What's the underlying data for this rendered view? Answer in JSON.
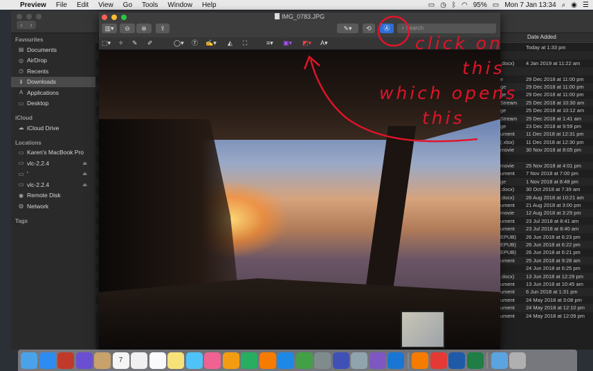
{
  "menubar": {
    "app_name": "Preview",
    "menus": [
      "File",
      "Edit",
      "View",
      "Go",
      "Tools",
      "Window",
      "Help"
    ],
    "battery": "95%",
    "clock": "Mon 7 Jan  13:34"
  },
  "finder": {
    "sidebar": {
      "favourites_heading": "Favourites",
      "favourites": [
        {
          "label": "Documents",
          "icon": "document-icon"
        },
        {
          "label": "AirDrop",
          "icon": "airdrop-icon"
        },
        {
          "label": "Recents",
          "icon": "clock-icon"
        },
        {
          "label": "Downloads",
          "icon": "download-icon",
          "selected": true
        },
        {
          "label": "Applications",
          "icon": "applications-icon"
        },
        {
          "label": "Desktop",
          "icon": "desktop-icon"
        }
      ],
      "icloud_heading": "iCloud",
      "icloud": [
        {
          "label": "iCloud Drive",
          "icon": "cloud-icon"
        }
      ],
      "locations_heading": "Locations",
      "locations": [
        {
          "label": "Karen's MacBook Pro",
          "icon": "laptop-icon",
          "eject": false
        },
        {
          "label": "vlc-2.2.4",
          "icon": "disk-icon",
          "eject": true
        },
        {
          "label": "'",
          "icon": "disk-icon",
          "eject": true
        },
        {
          "label": "vlc-2.2.4",
          "icon": "disk-icon",
          "eject": true
        },
        {
          "label": "Remote Disk",
          "icon": "remote-disk-icon",
          "eject": false
        },
        {
          "label": "Network",
          "icon": "network-icon",
          "eject": false
        }
      ],
      "tags_heading": "Tags"
    },
    "list": {
      "date_header": "Date Added",
      "rows": [
        {
          "kind": "",
          "date": "Today at 1:33 pm"
        },
        {
          "kind": "",
          "date": ""
        },
        {
          "kind": ".docx)",
          "date": "4 Jan 2019 at 11:22 am"
        },
        {
          "kind": "",
          "date": ""
        },
        {
          "kind": "e",
          "date": "29 Dec 2018 at 11:00 pm"
        },
        {
          "kind": "ge",
          "date": "29 Dec 2018 at 11:00 pm"
        },
        {
          "kind": "ge",
          "date": "29 Dec 2018 at 11:00 pm"
        },
        {
          "kind": "Stream",
          "date": "25 Dec 2018 at 10:30 am"
        },
        {
          "kind": "ge",
          "date": "25 Dec 2018 at 10:12 am"
        },
        {
          "kind": "Stream",
          "date": "25 Dec 2018 at 1:41 am"
        },
        {
          "kind": "ge",
          "date": "23 Dec 2018 at 9:59 pm"
        },
        {
          "kind": "ument",
          "date": "11 Dec 2018 at 12:31 pm"
        },
        {
          "kind": "(.xlsx)",
          "date": "11 Dec 2018 at 12:30 pm"
        },
        {
          "kind": "movie",
          "date": "30 Nov 2018 at 8:05 pm"
        },
        {
          "kind": "",
          "date": ""
        },
        {
          "kind": "movie",
          "date": "25 Nov 2018 at 4:01 pm"
        },
        {
          "kind": "ument",
          "date": "7 Nov 2018 at 7:00 pm"
        },
        {
          "kind": "ge",
          "date": "1 Nov 2018 at 8:48 pm"
        },
        {
          "kind": ".docx)",
          "date": "30 Oct 2018 at 7:39 am"
        },
        {
          "kind": ".docx)",
          "date": "28 Aug 2018 at 10:21 am"
        },
        {
          "kind": "ument",
          "date": "21 Aug 2018 at 3:00 pm"
        },
        {
          "kind": "movie",
          "date": "12 Aug 2018 at 3:29 pm"
        },
        {
          "kind": "ument",
          "date": "23 Jul 2018 at 8:41 am"
        },
        {
          "kind": "ument",
          "date": "23 Jul 2018 at 8:40 am"
        },
        {
          "kind": "EPUB)",
          "date": "26 Jun 2018 at 6:23 pm"
        },
        {
          "kind": "EPUB)",
          "date": "26 Jun 2018 at 6:22 pm"
        },
        {
          "kind": "EPUB)",
          "date": "26 Jun 2018 at 6:21 pm"
        },
        {
          "kind": "ument",
          "date": "25 Jun 2018 at 9:28 am"
        },
        {
          "kind": "",
          "date": "24 Jun 2018 at 6:25 pm"
        },
        {
          "kind": ".docx)",
          "date": "13 Jun 2018 at 12:29 pm"
        },
        {
          "kind": "ument",
          "date": "13 Jun 2018 at 10:45 am"
        },
        {
          "kind": "ument",
          "date": "6 Jun 2018 at 1:31 pm"
        },
        {
          "kind": "ument",
          "date": "24 May 2018 at 3:08 pm"
        },
        {
          "kind": "ument",
          "date": "24 May 2018 at 12:10 pm"
        },
        {
          "kind": "ument",
          "date": "24 May 2018 at 12:09 pm"
        }
      ]
    }
  },
  "preview": {
    "filename": "IMG_0783.JPG",
    "search_placeholder": "Search"
  },
  "annotations": {
    "line1": "click on",
    "line2": "this",
    "line3": "which opens",
    "line4": "this",
    "color": "#e0142a"
  },
  "dock": [
    {
      "name": "finder",
      "icon": "finder-icon",
      "color": "#4aa3e8"
    },
    {
      "name": "safari",
      "icon": "safari-icon",
      "color": "#2d8cf0"
    },
    {
      "name": "photo-booth",
      "icon": "photo-booth-icon",
      "color": "#c0392b"
    },
    {
      "name": "siri",
      "icon": "siri-icon",
      "color": "#6a4fd0"
    },
    {
      "name": "contacts",
      "icon": "contacts-icon",
      "color": "#c9a26b"
    },
    {
      "name": "calendar",
      "icon": "calendar-icon",
      "color": "#f5f5f5",
      "text": "7"
    },
    {
      "name": "photos",
      "icon": "photos-icon",
      "color": "#f0f0f0"
    },
    {
      "name": "reminders",
      "icon": "reminders-icon",
      "color": "#fafafa"
    },
    {
      "name": "notes",
      "icon": "notes-icon",
      "color": "#f7e27a"
    },
    {
      "name": "messages",
      "icon": "messages-icon",
      "color": "#4fc3f7"
    },
    {
      "name": "itunes",
      "icon": "music-icon",
      "color": "#f06292"
    },
    {
      "name": "pages",
      "icon": "pages-icon",
      "color": "#f39c12"
    },
    {
      "name": "numbers",
      "icon": "numbers-icon",
      "color": "#27ae60"
    },
    {
      "name": "vlc",
      "icon": "vlc-icon",
      "color": "#f57c00"
    },
    {
      "name": "app-store",
      "icon": "app-store-icon",
      "color": "#1e88e5"
    },
    {
      "name": "facetime",
      "icon": "facetime-icon",
      "color": "#43a047"
    },
    {
      "name": "system-preferences",
      "icon": "gear-icon",
      "color": "#7f8c8d"
    },
    {
      "name": "imovie",
      "icon": "imovie-icon",
      "color": "#3f51b5"
    },
    {
      "name": "preview",
      "icon": "preview-icon",
      "color": "#90a4ae"
    },
    {
      "name": "imovie-star",
      "icon": "star-icon",
      "color": "#7e57c2"
    },
    {
      "name": "keynote",
      "icon": "keynote-icon",
      "color": "#1976d2"
    },
    {
      "name": "sep",
      "icon": "",
      "color": ""
    },
    {
      "name": "vlc-2",
      "icon": "vlc-icon",
      "color": "#f57c00"
    },
    {
      "name": "acrobat",
      "icon": "pdf-icon",
      "color": "#e53935"
    },
    {
      "name": "word",
      "icon": "word-icon",
      "color": "#1e5aa8"
    },
    {
      "name": "excel",
      "icon": "excel-icon",
      "color": "#1e7e45"
    },
    {
      "name": "sep2",
      "icon": "",
      "color": ""
    },
    {
      "name": "downloads-folder",
      "icon": "folder-icon",
      "color": "#5ba4e0"
    },
    {
      "name": "trash",
      "icon": "trash-icon",
      "color": "#b0b0b0"
    }
  ]
}
